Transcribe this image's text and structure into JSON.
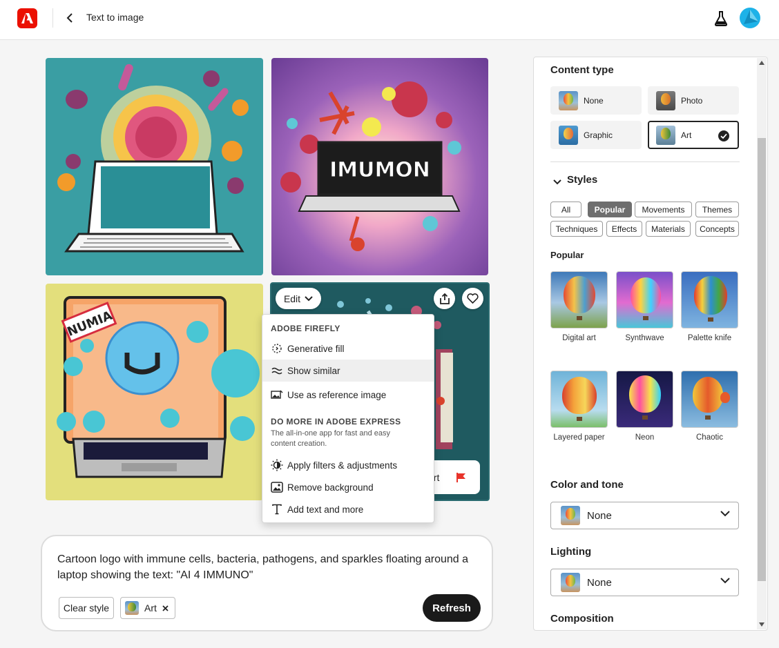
{
  "header": {
    "title": "Text to image"
  },
  "menu": {
    "section1_title": "ADOBE FIREFLY",
    "items1": [
      {
        "label": "Generative fill",
        "icon": "generative-fill-icon"
      },
      {
        "label": "Show similar",
        "icon": "show-similar-icon"
      },
      {
        "label": "Use as reference image",
        "icon": "reference-image-icon"
      }
    ],
    "section2_title": "DO MORE IN ADOBE EXPRESS",
    "section2_desc": "The all-in-one app for fast and easy content creation.",
    "items2": [
      {
        "label": "Apply filters & adjustments",
        "icon": "filters-icon"
      },
      {
        "label": "Remove background",
        "icon": "remove-background-icon"
      },
      {
        "label": "Add text and more",
        "icon": "add-text-icon"
      }
    ]
  },
  "image_actions": {
    "edit_label": "Edit",
    "report_label": "ort"
  },
  "image_texts": {
    "tile2": "IMUMON",
    "tile3": "NUMIA"
  },
  "prompt": {
    "text": "Cartoon logo with immune cells, bacteria, pathogens, and sparkles floating around a laptop showing the text: \"AI 4 IMMUNO\"",
    "clear_style_label": "Clear style",
    "style_chip_label": "Art",
    "refresh_label": "Refresh"
  },
  "panel": {
    "content_type_title": "Content type",
    "content_types": [
      {
        "label": "None",
        "selected": false
      },
      {
        "label": "Photo",
        "selected": false
      },
      {
        "label": "Graphic",
        "selected": false
      },
      {
        "label": "Art",
        "selected": true
      }
    ],
    "styles_title": "Styles",
    "style_filters": [
      {
        "label": "All",
        "active": false
      },
      {
        "label": "Popular",
        "active": true
      },
      {
        "label": "Movements",
        "active": false
      },
      {
        "label": "Themes",
        "active": false
      },
      {
        "label": "Techniques",
        "active": false
      },
      {
        "label": "Effects",
        "active": false
      },
      {
        "label": "Materials",
        "active": false
      },
      {
        "label": "Concepts",
        "active": false
      }
    ],
    "popular_title": "Popular",
    "popular_styles": [
      {
        "label": "Digital art"
      },
      {
        "label": "Synthwave"
      },
      {
        "label": "Palette knife"
      },
      {
        "label": "Layered paper"
      },
      {
        "label": "Neon"
      },
      {
        "label": "Chaotic"
      }
    ],
    "color_tone_title": "Color and tone",
    "color_tone_value": "None",
    "lighting_title": "Lighting",
    "lighting_value": "None",
    "composition_title": "Composition"
  },
  "colors": {
    "brand": "#eb1000",
    "avatar": "#1db2e8",
    "refresh_bg": "#1a1a1a",
    "report_flag": "#e8332a"
  }
}
